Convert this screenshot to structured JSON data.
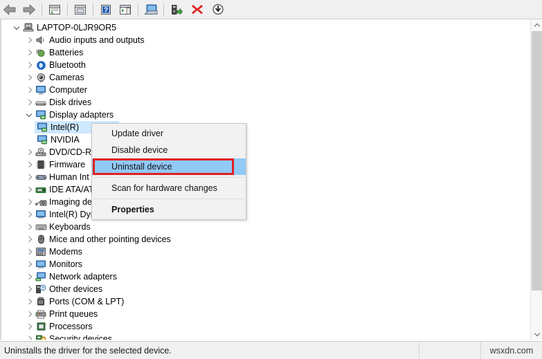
{
  "toolbar": {
    "buttons": [
      {
        "name": "back-button",
        "icon": "arrow-left-icon",
        "label": "Back"
      },
      {
        "name": "forward-button",
        "icon": "arrow-right-icon",
        "label": "Forward"
      },
      {
        "name": "up-one-level-button",
        "icon": "up-level-icon",
        "label": "Up one level"
      },
      {
        "name": "properties-button",
        "icon": "properties-window-icon",
        "label": "Properties"
      },
      {
        "name": "help-button",
        "icon": "help-question-icon",
        "label": "Help"
      },
      {
        "name": "show-hidden-button",
        "icon": "play-window-icon",
        "label": "Show hidden devices"
      },
      {
        "name": "scan-hardware-button",
        "icon": "computer-scan-icon",
        "label": "Scan for hardware changes"
      },
      {
        "name": "update-driver-button",
        "icon": "update-driver-icon",
        "label": "Update driver"
      },
      {
        "name": "uninstall-button",
        "icon": "red-x-icon",
        "label": "Uninstall device"
      },
      {
        "name": "disable-button",
        "icon": "disable-arrow-icon",
        "label": "Disable device"
      }
    ]
  },
  "tree": {
    "root": {
      "label": "LAPTOP-0LJR9OR5",
      "icon": "computer-root-icon",
      "expanded": true
    },
    "items": [
      {
        "label": "Audio inputs and outputs",
        "icon": "speaker-icon",
        "depth": 1,
        "expandable": true,
        "expanded": false
      },
      {
        "label": "Batteries",
        "icon": "battery-icon",
        "depth": 1,
        "expandable": true,
        "expanded": false
      },
      {
        "label": "Bluetooth",
        "icon": "bluetooth-icon",
        "depth": 1,
        "expandable": true,
        "expanded": false
      },
      {
        "label": "Cameras",
        "icon": "camera-icon",
        "depth": 1,
        "expandable": true,
        "expanded": false
      },
      {
        "label": "Computer",
        "icon": "monitor-icon",
        "depth": 1,
        "expandable": true,
        "expanded": false
      },
      {
        "label": "Disk drives",
        "icon": "disk-drive-icon",
        "depth": 1,
        "expandable": true,
        "expanded": false
      },
      {
        "label": "Display adapters",
        "icon": "display-adapter-icon",
        "depth": 1,
        "expandable": true,
        "expanded": true
      },
      {
        "label": "Intel(R)",
        "icon": "display-adapter-icon",
        "depth": 2,
        "expandable": false,
        "expanded": false,
        "selected": true
      },
      {
        "label": "NVIDIA",
        "icon": "display-adapter-icon",
        "depth": 2,
        "expandable": false,
        "expanded": false
      },
      {
        "label": "DVD/CD-R",
        "icon": "dvd-drive-icon",
        "depth": 1,
        "expandable": true,
        "expanded": false
      },
      {
        "label": "Firmware",
        "icon": "firmware-chip-icon",
        "depth": 1,
        "expandable": true,
        "expanded": false
      },
      {
        "label": "Human Int",
        "icon": "hid-icon",
        "depth": 1,
        "expandable": true,
        "expanded": false
      },
      {
        "label": "IDE ATA/AT",
        "icon": "ide-controller-icon",
        "depth": 1,
        "expandable": true,
        "expanded": false
      },
      {
        "label": "Imaging de",
        "icon": "imaging-device-icon",
        "depth": 1,
        "expandable": true,
        "expanded": false
      },
      {
        "label": "Intel(R) Dynamic Platform and Thermal Framework",
        "icon": "system-device-icon",
        "depth": 1,
        "expandable": true,
        "expanded": false
      },
      {
        "label": "Keyboards",
        "icon": "keyboard-icon",
        "depth": 1,
        "expandable": true,
        "expanded": false
      },
      {
        "label": "Mice and other pointing devices",
        "icon": "mouse-icon",
        "depth": 1,
        "expandable": true,
        "expanded": false
      },
      {
        "label": "Modems",
        "icon": "modem-icon",
        "depth": 1,
        "expandable": true,
        "expanded": false
      },
      {
        "label": "Monitors",
        "icon": "monitor-icon",
        "depth": 1,
        "expandable": true,
        "expanded": false
      },
      {
        "label": "Network adapters",
        "icon": "network-adapter-icon",
        "depth": 1,
        "expandable": true,
        "expanded": false
      },
      {
        "label": "Other devices",
        "icon": "other-device-icon",
        "depth": 1,
        "expandable": true,
        "expanded": false
      },
      {
        "label": "Ports (COM & LPT)",
        "icon": "port-icon",
        "depth": 1,
        "expandable": true,
        "expanded": false
      },
      {
        "label": "Print queues",
        "icon": "printer-icon",
        "depth": 1,
        "expandable": true,
        "expanded": false
      },
      {
        "label": "Processors",
        "icon": "processor-icon",
        "depth": 1,
        "expandable": true,
        "expanded": false
      },
      {
        "label": "Security devices",
        "icon": "security-device-icon",
        "depth": 1,
        "expandable": true,
        "expanded": false
      }
    ]
  },
  "context_menu": {
    "items": [
      {
        "label": "Update driver",
        "type": "item",
        "highlighted": false,
        "bold": false
      },
      {
        "label": "Disable device",
        "type": "item",
        "highlighted": false,
        "bold": false
      },
      {
        "label": "Uninstall device",
        "type": "item",
        "highlighted": true,
        "bold": false
      },
      {
        "label": "",
        "type": "separator"
      },
      {
        "label": "Scan for hardware changes",
        "type": "item",
        "highlighted": false,
        "bold": false
      },
      {
        "label": "",
        "type": "separator"
      },
      {
        "label": "Properties",
        "type": "item",
        "highlighted": false,
        "bold": true
      }
    ],
    "highlight_color": "#91c9f7",
    "annotation_color": "#e02020"
  },
  "status_bar": {
    "message": "Uninstalls the driver for the selected device.",
    "watermark": "wsxdn.com"
  },
  "scrollbar": {
    "up_arrow": "scroll-up-icon",
    "down_arrow": "scroll-down-icon"
  }
}
